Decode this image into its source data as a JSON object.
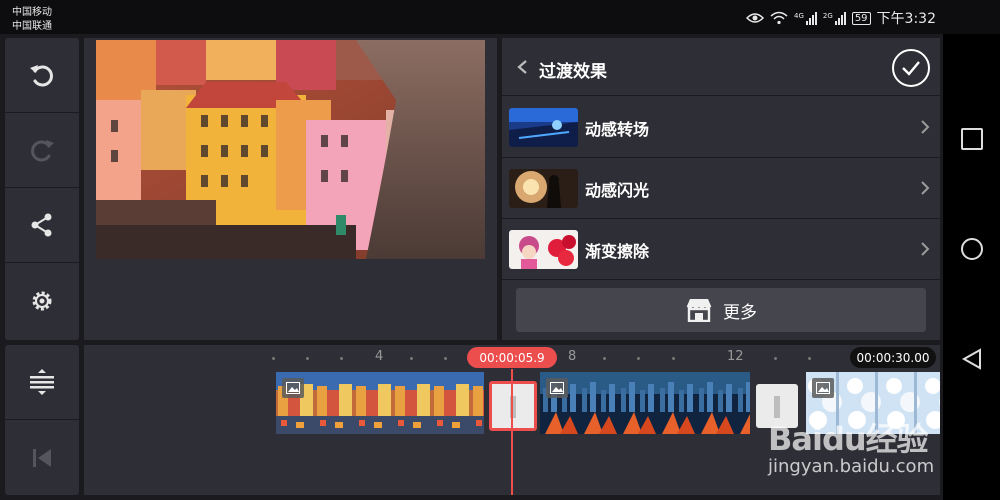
{
  "status_bar": {
    "carrier_1": "中国移动",
    "carrier_2": "中国联通",
    "net_tag_1": "4G",
    "net_tag_2": "2G",
    "battery": "59",
    "time": "下午3:32"
  },
  "transition_panel": {
    "title": "过渡效果",
    "items": [
      {
        "label": "动感转场",
        "thumb": "blue-sunset-road"
      },
      {
        "label": "动感闪光",
        "thumb": "silhouette-sunset"
      },
      {
        "label": "渐变擦除",
        "thumb": "girl-with-flowers"
      }
    ],
    "more_label": "更多"
  },
  "timeline": {
    "ruler_labels": [
      "4",
      "8",
      "12"
    ],
    "playhead_time": "00:00:05.9",
    "total_time": "00:00:30.00"
  },
  "watermark": {
    "logo": "Baidu经验",
    "url": "jingyan.baidu.com"
  },
  "colors": {
    "accent": "#ec4d4d",
    "panel": "#2e2e36",
    "background": "#1b1b1f"
  },
  "icons": {
    "side_toolbar": [
      "undo-icon",
      "redo-icon",
      "share-icon",
      "settings-icon",
      "layers-icon",
      "skip-to-start-icon"
    ],
    "nav": [
      "recent-apps-icon",
      "home-icon",
      "back-icon"
    ]
  }
}
